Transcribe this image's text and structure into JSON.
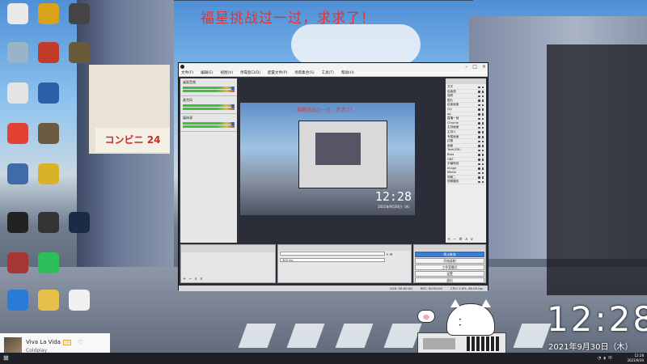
{
  "headline": "福星挑战过一过，求求了！",
  "desktop_icons": [
    {
      "label": "",
      "icon": "app-logo-icon",
      "color": "#e9e9e9"
    },
    {
      "label": "",
      "icon": "yellow-app-icon",
      "color": "#d8a21b"
    },
    {
      "label": "",
      "icon": "camera-icon",
      "color": "#444"
    },
    {
      "label": "",
      "icon": "recycle-bin-icon",
      "color": "#9bb3c7"
    },
    {
      "label": "",
      "icon": "pirate-game-icon",
      "color": "#c23a2a"
    },
    {
      "label": "",
      "icon": "game-icon",
      "color": "#6a5a3a"
    },
    {
      "label": "",
      "icon": "document-icon",
      "color": "#e4e4e4"
    },
    {
      "label": "",
      "icon": "blue-app-icon",
      "color": "#2b5fa8"
    },
    {
      "label": "",
      "icon": "chrome-icon",
      "color": "#e34133"
    },
    {
      "label": "",
      "icon": "pubg-icon",
      "color": "#6b5a3f"
    },
    {
      "label": "",
      "icon": "computer-icon",
      "color": "#3e6ca8"
    },
    {
      "label": "",
      "icon": "yellow-cat-icon",
      "color": "#d9b22a"
    },
    {
      "label": "",
      "icon": "obs-icon",
      "color": "#222"
    },
    {
      "label": "",
      "icon": "obs-icon",
      "color": "#333"
    },
    {
      "label": "",
      "icon": "steam-icon",
      "color": "#1b2b46"
    },
    {
      "label": "",
      "icon": "game-icon",
      "color": "#a63535"
    },
    {
      "label": "",
      "icon": "game-icon",
      "color": "#e08a2a"
    },
    {
      "label": "",
      "icon": "wechat-icon",
      "color": "#2bbf5c"
    },
    {
      "label": "",
      "icon": "app-icon",
      "color": "#2a7bd6"
    },
    {
      "label": "",
      "icon": "folder-icon",
      "color": "#e7c04a"
    },
    {
      "label": "",
      "icon": "blank-file-icon",
      "color": "#f0f0f0"
    }
  ],
  "obs": {
    "menus": [
      "文件(F)",
      "编辑(E)",
      "视图(V)",
      "停靠窗口(D)",
      "配置文件(P)",
      "场景集合(S)",
      "工具(T)",
      "帮助(H)"
    ],
    "sources": [
      "文字",
      "结束语",
      "追踪",
      "图片",
      "结束画面",
      "QQ",
      "qq",
      "直播一帧",
      "Chrome",
      "主持画面",
      "主持人",
      "专属画面",
      "边框",
      "画面",
      "Text(GDI)",
      "Bass",
      "OBS",
      "字幕特效",
      "Image",
      "Media",
      "场景二",
      "视频播放"
    ],
    "mixer_tracks": [
      {
        "name": "桌面音频"
      },
      {
        "name": "麦克风"
      },
      {
        "name": "媒体源"
      }
    ],
    "transition_duration": "300 ms",
    "controls": [
      "停止推流",
      "开始录制",
      "工作室模式",
      "设置",
      "退出"
    ],
    "status": [
      "LIVE: 00:00:00",
      "REC: 00:00:00",
      "CPU: 1.9%, 60.00 fps"
    ]
  },
  "preview": {
    "clock": "12:28",
    "date": "2021年9月30日（木）"
  },
  "clock": {
    "time": "12:28",
    "date": "2021年9月30日（木）"
  },
  "music": {
    "title": "Viva La Vida",
    "artist": "Coldplay"
  },
  "taskbar": {
    "time": "12:28",
    "date": "2021/9/30"
  }
}
